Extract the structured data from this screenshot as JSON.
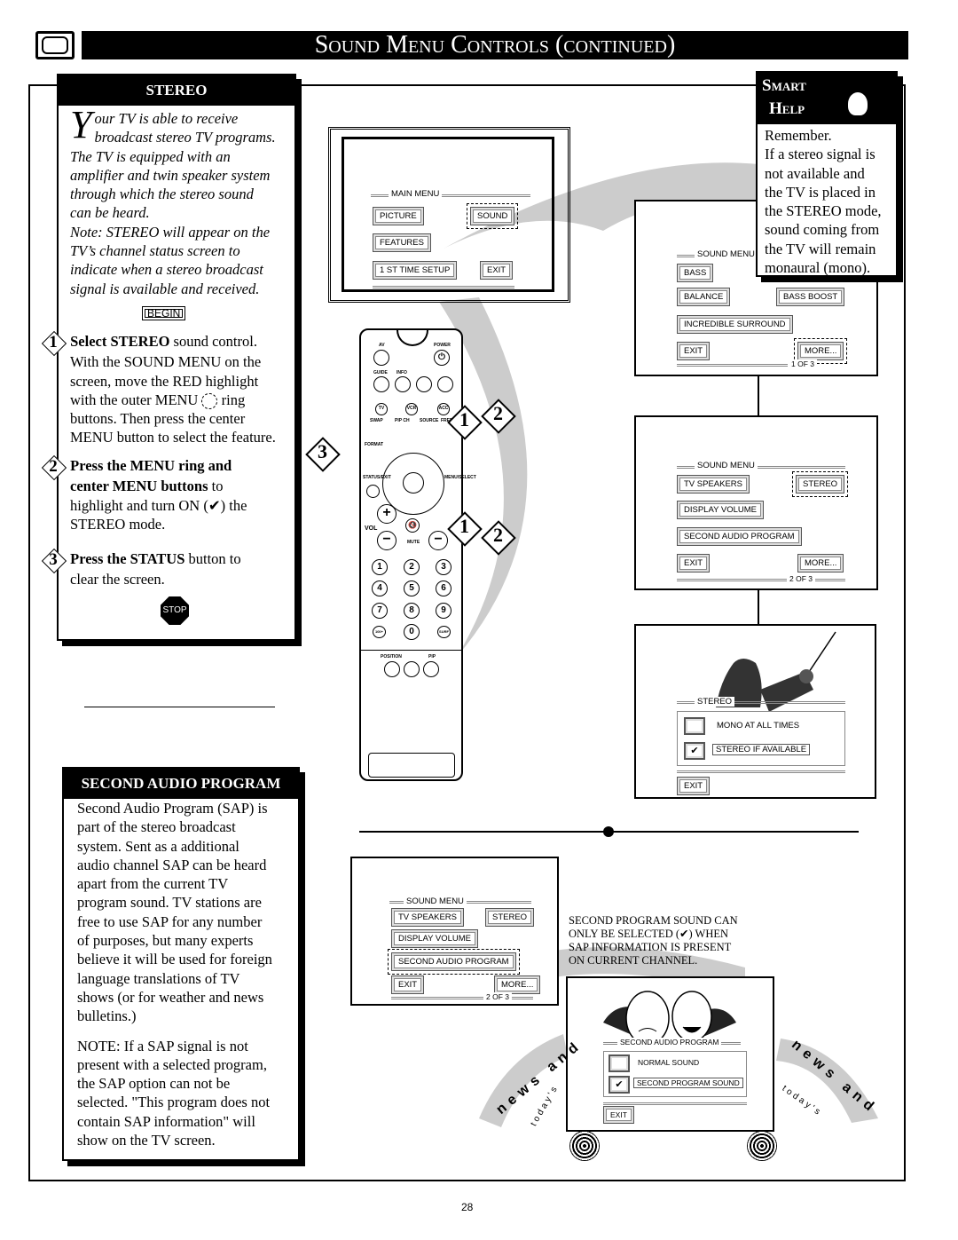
{
  "header": {
    "title": "Sound Menu Controls (continued)",
    "page_number": "28"
  },
  "stereo": {
    "heading": "STEREO",
    "dropcap": "Y",
    "intro_lines": [
      "our TV is able to receive",
      "broadcast stereo TV programs.",
      "The TV is equipped with an",
      "amplifier and twin speaker system",
      "through which the stereo sound",
      "can be heard.",
      "Note: STEREO will appear on the",
      "TV’s channel status screen to",
      "indicate when a stereo broadcast",
      "signal is available and received."
    ],
    "begin": "BEGIN",
    "steps": [
      {
        "num": "1",
        "bold": "Select STEREO",
        "rest": " sound control.",
        "lines": [
          "With the SOUND MENU on the",
          "screen, move the RED highlight",
          "with the outer MENU",
          "ring",
          "buttons. Then press the center",
          "MENU button to select the feature."
        ]
      },
      {
        "num": "2",
        "bold": "Press the MENU ring and",
        "lines_bold": "center MENU buttons",
        "lines": [
          " to",
          "highlight and turn ON (✔) the",
          "STEREO mode."
        ]
      },
      {
        "num": "3",
        "bold": "Press the STATUS",
        "rest": " button to",
        "lines": [
          "clear the screen."
        ]
      }
    ],
    "stop": "STOP"
  },
  "sap": {
    "heading": "SECOND AUDIO PROGRAM",
    "lines": [
      "Second Audio Program (SAP) is",
      "part of the stereo broadcast",
      "system.  Sent as a additional",
      "audio channel SAP can be heard",
      "apart from the current TV",
      "program sound. TV stations are",
      "free to use SAP for any number",
      "of purposes, but many experts",
      "believe it will be used for foreign",
      "language translations of TV",
      "shows (or for weather and news",
      "bulletins.)"
    ],
    "note_lines": [
      "NOTE: If a SAP signal is not",
      "present with a selected program,",
      "the SAP option can not be",
      "selected.  \"This program does not",
      "contain SAP information\" will",
      "show on the TV screen."
    ]
  },
  "smart_help": {
    "title1": "Smart",
    "title2": "Help",
    "lines": [
      "Remember.",
      "If a stereo signal is",
      "not available and",
      "the TV is placed in",
      "the STEREO mode,",
      "sound coming from",
      "the TV will remain",
      "monaural (mono)."
    ]
  },
  "main_menu": {
    "title": "MAIN MENU",
    "picture": "PICTURE",
    "sound": "SOUND",
    "features": "FEATURES",
    "setup": "1 ST TIME SETUP",
    "exit": "EXIT"
  },
  "sound_menu1": {
    "title": "SOUND MENU",
    "bass": "BASS",
    "balance": "BALANCE",
    "bass_boost": "BASS BOOST",
    "surround": "INCREDIBLE SURROUND",
    "exit": "EXIT",
    "more": "MORE...",
    "page": "1 OF 3"
  },
  "sound_menu2": {
    "title": "SOUND MENU",
    "tv_speakers": "TV SPEAKERS",
    "stereo": "STEREO",
    "display_volume": "DISPLAY VOLUME",
    "sap": "SECOND AUDIO PROGRAM",
    "exit": "EXIT",
    "more": "MORE...",
    "page": "2  OF 3"
  },
  "stereo_menu": {
    "title": "STEREO",
    "mono": "MONO AT ALL TIMES",
    "stereo_if": "STEREO IF AVAILABLE",
    "exit": "EXIT",
    "selected": "STEREO IF AVAILABLE"
  },
  "sound_menu3": {
    "title": "SOUND MENU",
    "tv_speakers": "TV SPEAKERS",
    "stereo": "STEREO",
    "display_volume": "DISPLAY VOLUME",
    "sap": "SECOND AUDIO PROGRAM",
    "exit": "EXIT",
    "more": "MORE...",
    "page": "2  OF 3"
  },
  "sap_note": [
    "SECOND PROGRAM SOUND CAN",
    "ONLY BE SELECTED (✔) WHEN",
    "SAP INFORMATION IS PRESENT",
    "ON CURRENT CHANNEL."
  ],
  "sap_menu": {
    "title": "SECOND AUDIO PROGRAM",
    "normal": "NORMAL SOUND",
    "second": "SECOND PROGRAM SOUND",
    "exit": "EXIT",
    "selected": "SECOND PROGRAM SOUND"
  },
  "decor": {
    "left_arc": "news and",
    "left_arc2": "today's",
    "right_arc": "news and",
    "right_arc2": "today's"
  },
  "remote": {
    "labels": [
      "AV",
      "POWER",
      "GUIDE",
      "INFO",
      "TV",
      "VCR",
      "ACC",
      "SWAP",
      "PIP CH",
      "SOURCE",
      "FREEZE",
      "FORMAT",
      "STATUS/EXIT",
      "MENU/SELECT",
      "VOL",
      "MUTE",
      "POSITION",
      "PIP"
    ],
    "digits": [
      "1",
      "2",
      "3",
      "4",
      "5",
      "6",
      "7",
      "8",
      "9",
      "100+",
      "0",
      "SURF"
    ],
    "callouts": [
      "1",
      "2",
      "3"
    ]
  },
  "colors": {
    "swoosh": "#cccccc",
    "bar": "#000000"
  }
}
